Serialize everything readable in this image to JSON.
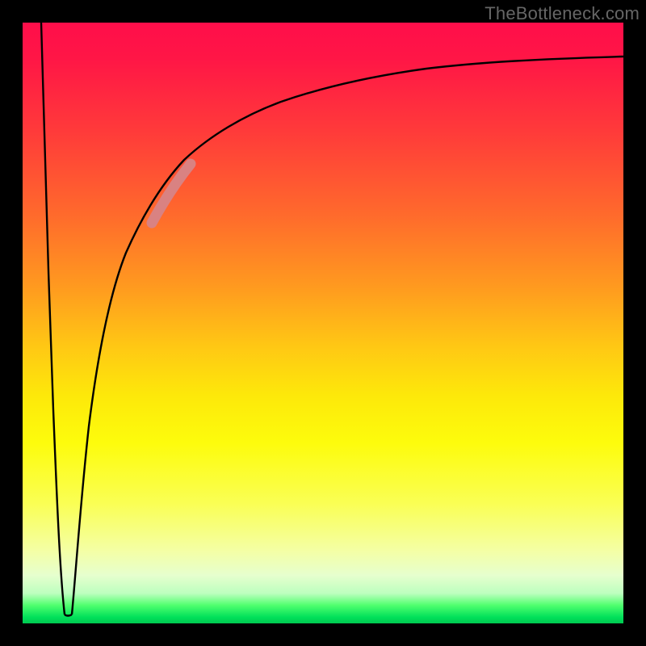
{
  "watermark": "TheBottleneck.com",
  "colors": {
    "frame": "#000000",
    "curve": "#000000",
    "highlight": "#d98282",
    "watermark": "#666666"
  },
  "chart_data": {
    "type": "line",
    "title": "",
    "xlabel": "",
    "ylabel": "",
    "xlim": [
      0,
      100
    ],
    "ylim": [
      0,
      100
    ],
    "grid": false,
    "legend": false,
    "series": [
      {
        "name": "descending-left-edge",
        "x": [
          3.1,
          4.0,
          4.6,
          5.1,
          5.6,
          6.1,
          6.6,
          7.0
        ],
        "y": [
          100,
          80,
          60,
          40,
          25,
          12,
          5,
          1.5
        ]
      },
      {
        "name": "ascending-main-curve",
        "x": [
          8.2,
          9,
          10,
          12,
          14,
          16,
          18,
          20,
          23,
          26,
          30,
          35,
          40,
          46,
          54,
          64,
          76,
          88,
          100
        ],
        "y": [
          1.5,
          10,
          20,
          34,
          45,
          53,
          59.5,
          64.5,
          70,
          74,
          78,
          81.5,
          84.5,
          87,
          89.2,
          91,
          92.6,
          93.7,
          94.4
        ]
      }
    ],
    "annotations": [
      {
        "name": "highlight-segment",
        "x_range": [
          21.5,
          28
        ],
        "description": "salmon thick overlay on rising curve"
      }
    ]
  }
}
